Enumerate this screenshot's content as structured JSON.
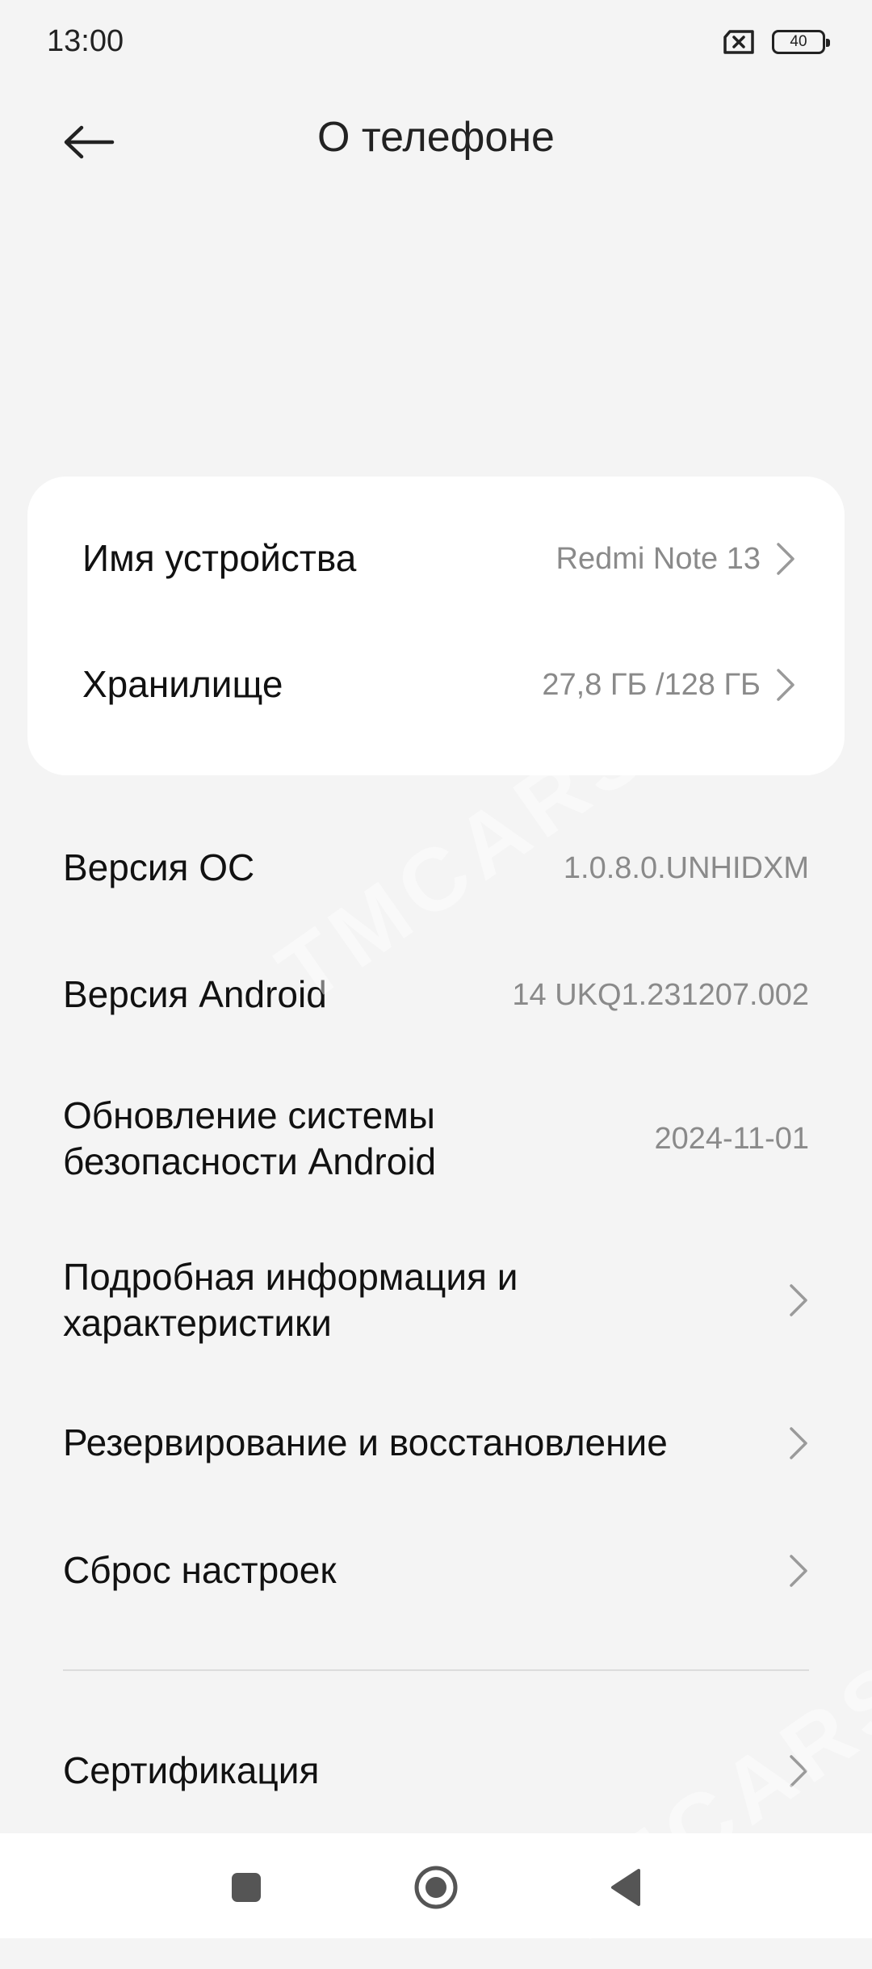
{
  "status_bar": {
    "time": "13:00",
    "battery_level": "40"
  },
  "header": {
    "title": "О телефоне"
  },
  "card": {
    "items": [
      {
        "label": "Имя устройства",
        "value": "Redmi Note 13"
      },
      {
        "label": "Хранилище",
        "value": "27,8 ГБ /128 ГБ"
      }
    ]
  },
  "list": {
    "items": [
      {
        "label": "Версия ОС",
        "value": "1.0.8.0.UNHIDXM"
      },
      {
        "label": "Версия Android",
        "value": "14 UKQ1.231207.002"
      },
      {
        "label_line1": "Обновление системы",
        "label_line2": "безопасности Android",
        "value": "2024-11-01"
      },
      {
        "label_line1": "Подробная информация и",
        "label_line2": "характеристики"
      },
      {
        "label": "Резервирование и восстановление"
      },
      {
        "label": "Сброс настроек"
      },
      {
        "label": "Сертификация"
      }
    ]
  },
  "watermark": {
    "text": "TMCARS"
  },
  "colors": {
    "background": "#f4f4f4",
    "card": "#ffffff",
    "secondary_text": "#8a8a8a"
  }
}
